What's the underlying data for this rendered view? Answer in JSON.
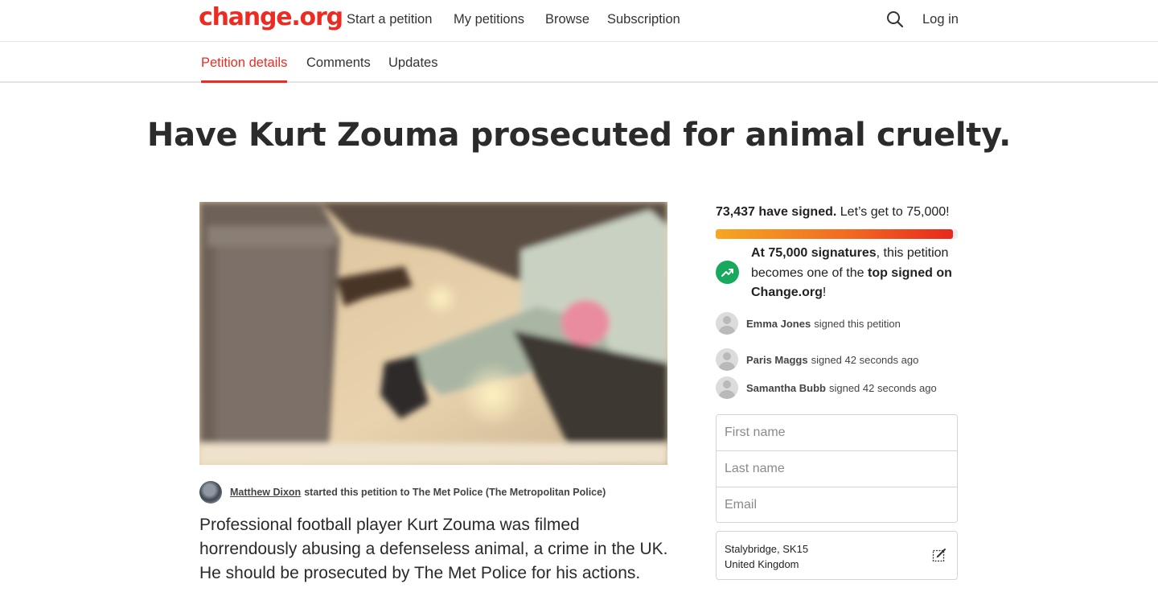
{
  "header": {
    "logo": "change.org",
    "nav": [
      "Start a petition",
      "My petitions",
      "Browse",
      "Subscription"
    ],
    "login": "Log in",
    "search_icon": "search-icon"
  },
  "tabs": [
    "Petition details",
    "Comments",
    "Updates"
  ],
  "petition": {
    "title": "Have Kurt Zouma prosecuted for animal cruelty.",
    "starter_name": "Matthew Dixon",
    "starter_text": "started this petition to The Met Police (The Metropolitan Police)",
    "description": "Professional football player Kurt Zouma was filmed horrendously abusing a defenseless animal, a crime in the UK. He should be prosecuted by The Met Police for his actions."
  },
  "sidebar": {
    "signed_count": "73,437 have signed.",
    "goal_text": "Let’s get to 75,000!",
    "progress_fraction": 0.979,
    "milestone": {
      "bold1": "At 75,000 signatures",
      "text1": ", this petition becomes one of the ",
      "bold2": "top signed on Change.org",
      "text2": "!"
    },
    "signers": [
      {
        "name": "Emma Jones",
        "text": "signed this petition"
      },
      {
        "name": "Paris Maggs",
        "text": "signed 42 seconds ago"
      },
      {
        "name": "Samantha Bubb",
        "text": "signed 42 seconds ago"
      }
    ],
    "form": {
      "first_name_placeholder": "First name",
      "last_name_placeholder": "Last name",
      "email_placeholder": "Email"
    },
    "location": {
      "line1": "Stalybridge, SK15",
      "line2": "United Kingdom"
    }
  },
  "colors": {
    "brand": "#ec2c22",
    "trend": "#17a95e"
  }
}
